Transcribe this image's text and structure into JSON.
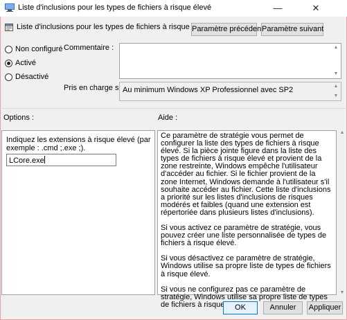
{
  "window": {
    "title": "Liste d'inclusions pour les types de fichiers à risque élevé",
    "minimize": "—",
    "close": "✕"
  },
  "header": {
    "title": "Liste d'inclusions pour les types de fichiers à risque élevé",
    "prev_button": "Paramètre précédent",
    "next_button": "Paramètre suivant"
  },
  "state": {
    "options": [
      {
        "label": "Non configuré",
        "checked": false
      },
      {
        "label": "Activé",
        "checked": true
      },
      {
        "label": "Désactivé",
        "checked": false
      }
    ]
  },
  "comment": {
    "label": "Commentaire :",
    "value": ""
  },
  "support": {
    "label": "Pris en charge sur :",
    "value": "Au minimum Windows XP Professionnel avec SP2"
  },
  "options_panel": {
    "label": "Options :",
    "description": "Indiquez les extensions à risque élevé (par exemple : .cmd ;.exe ;).",
    "input_value": "LCore.exe"
  },
  "help_panel": {
    "label": "Aide :",
    "paragraphs": [
      "Ce paramètre de stratégie vous permet de configurer la liste des types de fichiers à risque élevé. Si la pièce jointe figure dans la liste des types de fichiers à risque élevé et provient de la zone restreinte, Windows empêche l'utilisateur d'accéder au fichier. Si le fichier provient de la zone Internet, Windows demande à l'utilisateur s'il souhaite accéder au fichier. Cette liste d'inclusions a priorité sur les listes d'inclusions de risques modérés et faibles (quand une extension est répertoriée dans plusieurs listes d'inclusions).",
      "Si vous activez ce paramètre de stratégie, vous pouvez créer une liste personnalisée de types de fichiers à risque élevé.",
      "Si vous désactivez ce paramètre de stratégie, Windows utilise sa propre liste de types de fichiers à risque élevé.",
      "Si vous ne configurez pas ce paramètre de stratégie, Windows utilise sa propre liste de types de fichiers à risque élevé."
    ]
  },
  "footer": {
    "ok": "OK",
    "cancel": "Annuler",
    "apply": "Appliquer"
  },
  "icons": {
    "window_icon": "policy-window-icon",
    "header_icon": "setting-page-icon"
  }
}
